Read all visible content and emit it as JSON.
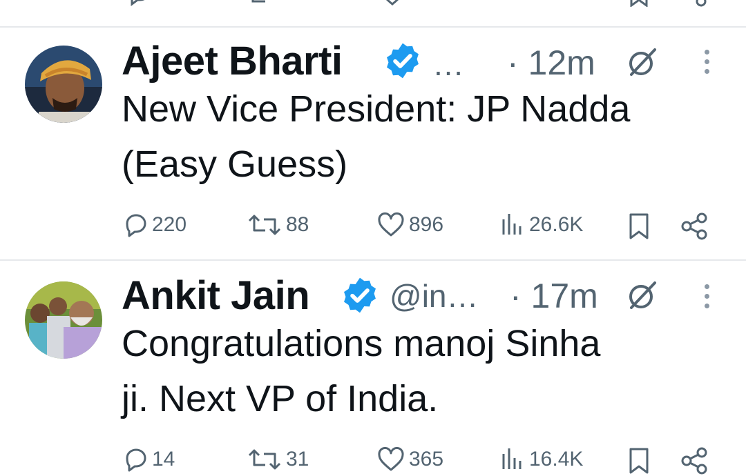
{
  "tweets": [
    {
      "name": "Ajeet Bharti",
      "handle": "…",
      "time": "· 12m",
      "text": "New Vice President: JP Nadda\n(Easy Guess)",
      "replies": "220",
      "retweets": "88",
      "likes": "896",
      "views": "26.6K"
    },
    {
      "name": "Ankit Jain",
      "handle": "@in…",
      "time": "· 17m",
      "text": "Congratulations manoj Sinha\nji. Next VP of India.",
      "replies": "14",
      "retweets": "31",
      "likes": "365",
      "views": "16.4K"
    }
  ],
  "icons": {
    "verified": "verified-badge-icon",
    "grok": "slash-circle-icon",
    "more": "more-vertical-icon",
    "reply": "reply-icon",
    "retweet": "retweet-icon",
    "like": "heart-icon",
    "views": "views-icon",
    "bookmark": "bookmark-icon",
    "share": "share-icon"
  },
  "colors": {
    "verified": "#1d9bf0",
    "muted": "#536471",
    "text": "#0f1419"
  }
}
